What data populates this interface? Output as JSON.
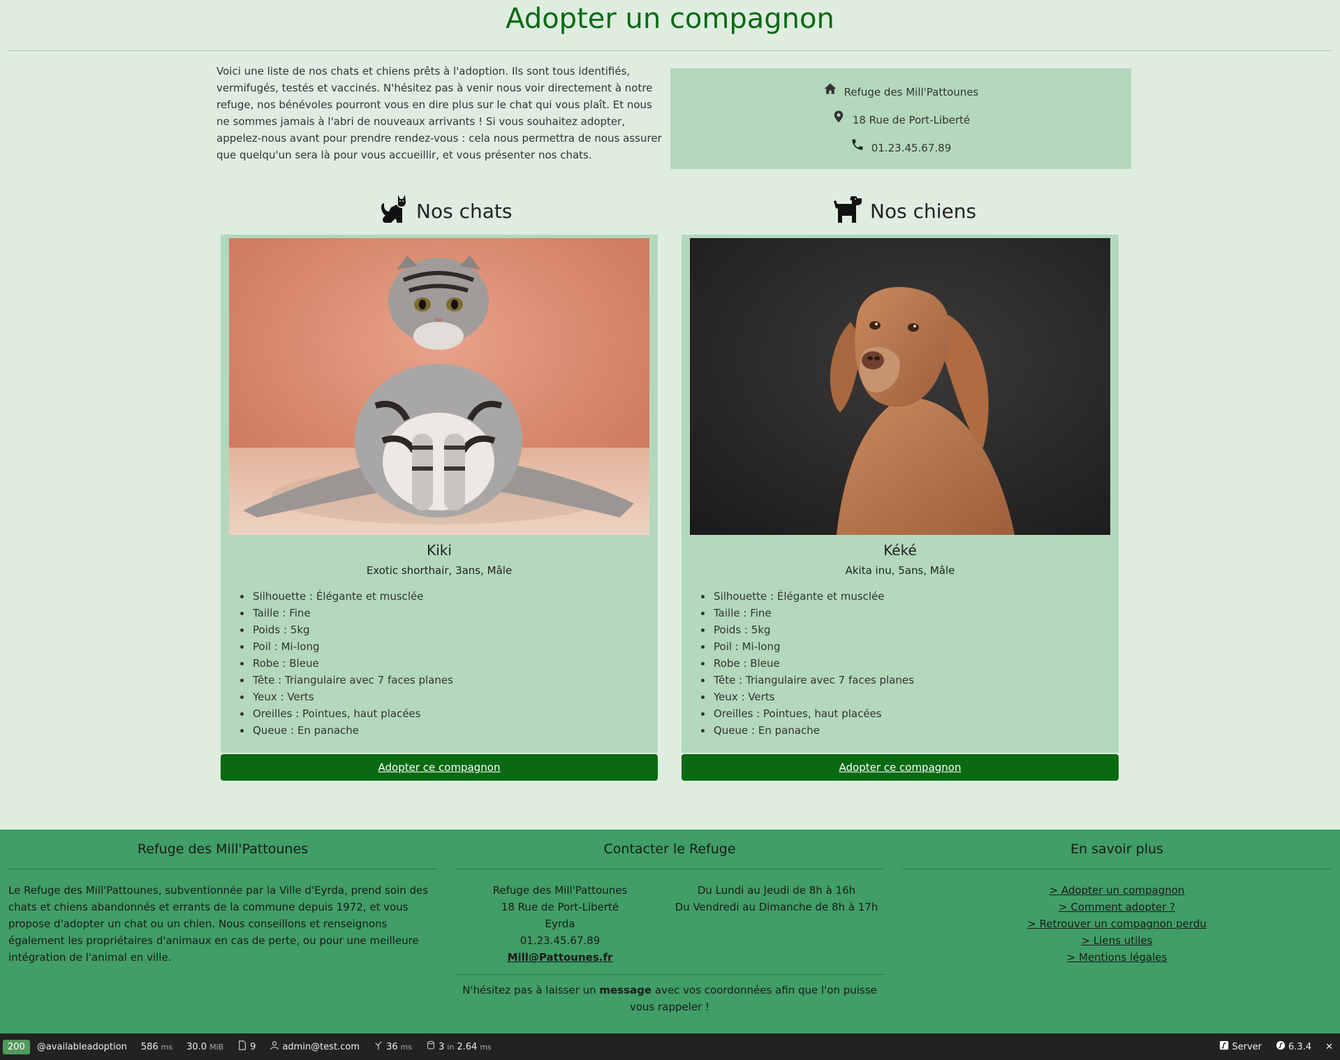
{
  "page": {
    "title": "Adopter un compagnon",
    "intro": "Voici une liste de nos chats et chiens prêts à l'adoption. Ils sont tous identifiés, vermifugés, testés et vaccinés. N'hésitez pas à venir nous voir directement à notre refuge, nos bénévoles pourront vous en dire plus sur le chat qui vous plaît. Et nous ne sommes jamais à l'abri de nouveaux arrivants ! Si vous souhaitez adopter, appelez-nous avant pour prendre rendez-vous : cela nous permettra de nous assurer que quelqu'un sera là pour vous accueillir, et vous présenter nos chats."
  },
  "info": {
    "name": "Refuge des Mill'Pattounes",
    "address": "18 Rue de Port-Liberté",
    "phone": "01.23.45.67.89"
  },
  "cats": {
    "heading": "Nos chats",
    "card": {
      "name": "Kiki",
      "subtitle": "Exotic shorthair, 3ans, Mâle",
      "traits": [
        "Silhouette : Élégante et musclée",
        "Taille : Fine",
        "Poids : 5kg",
        "Poil : Mi-long",
        "Robe : Bleue",
        "Tête : Triangulaire avec 7 faces planes",
        "Yeux : Verts",
        "Oreilles : Pointues, haut placées",
        "Queue : En panache"
      ],
      "button": "Adopter ce compagnon"
    }
  },
  "dogs": {
    "heading": "Nos chiens",
    "card": {
      "name": "Kéké",
      "subtitle": "Akita inu, 5ans, Mâle",
      "traits": [
        "Silhouette : Élégante et musclée",
        "Taille : Fine",
        "Poids : 5kg",
        "Poil : Mi-long",
        "Robe : Bleue",
        "Tête : Triangulaire avec 7 faces planes",
        "Yeux : Verts",
        "Oreilles : Pointues, haut placées",
        "Queue : En panache"
      ],
      "button": "Adopter ce compagnon"
    }
  },
  "footer": {
    "about": {
      "title": "Refuge des Mill'Pattounes",
      "text": "Le Refuge des Mill'Pattounes, subventionnée par la Ville d'Eyrda, prend soin des chats et chiens abandonnés et errants de la commune depuis 1972, et vous propose d'adopter un chat ou un chien. Nous conseillons et renseignons également les propriétaires d'animaux en cas de perte, ou pour une meilleure intégration de l'animal en ville."
    },
    "contact": {
      "title": "Contacter le Refuge",
      "name": "Refuge des Mill'Pattounes",
      "address": "18 Rue de Port-Liberté",
      "city": "Eyrda",
      "phone": "01.23.45.67.89",
      "email": "Mill@Pattounes.fr",
      "hours_weekday": "Du Lundi au Jeudi de 8h à 16h",
      "hours_weekend": "Du Vendredi au Dimanche de 8h à 17h",
      "note_before": "N'hésitez pas à laisser un ",
      "note_link": "message",
      "note_after": " avec vos coordonnées afin que l'on puisse vous rappeler !"
    },
    "more": {
      "title": "En savoir plus",
      "links": [
        "> Adopter un compagnon",
        "> Comment adopter ?",
        "> Retrouver un compagnon perdu",
        "> Liens utiles",
        "> Mentions légales"
      ]
    }
  },
  "debug": {
    "status": "200",
    "route": "@availableadoption",
    "time_value": "586",
    "time_unit": "ms",
    "memory_value": "30.0",
    "memory_unit": "MiB",
    "templates": "9",
    "user": "admin@test.com",
    "render_value": "36",
    "render_unit": "ms",
    "db_queries": "3",
    "db_in": "in",
    "db_time": "2.64",
    "db_unit": "ms",
    "server": "Server",
    "version": "6.3.4",
    "close": "✕"
  },
  "colors": {
    "background": "#deede0",
    "title": "#0a6a12",
    "panel": "#b3d8bc",
    "button": "#0a6a12",
    "footer": "#409e66",
    "debug_bar": "#222222"
  }
}
